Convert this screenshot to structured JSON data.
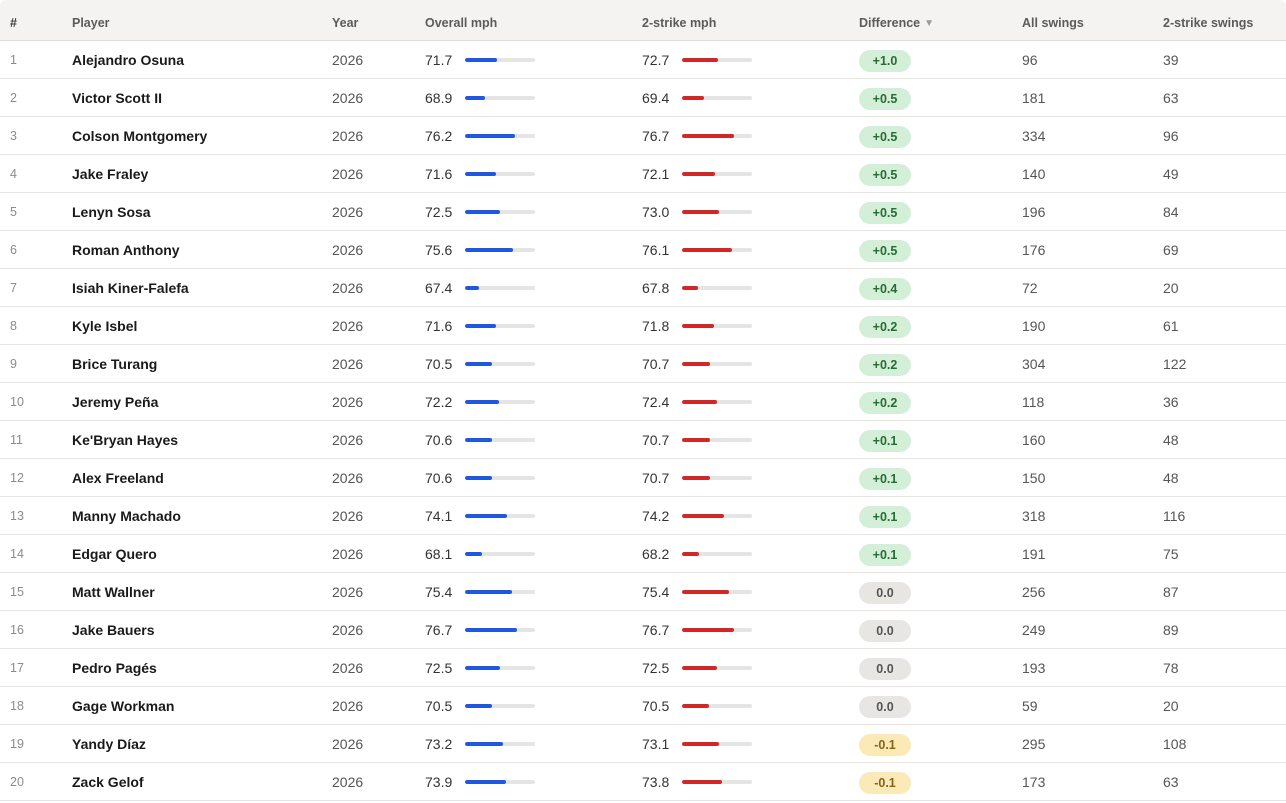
{
  "headers": {
    "rank": "#",
    "player": "Player",
    "year": "Year",
    "overall": "Overall mph",
    "two_strike": "2-strike mph",
    "difference": "Difference",
    "all_swings": "All swings",
    "two_strike_swings": "2-strike swings",
    "sort_icon": "sort-descending-icon",
    "sort_glyph": "▼"
  },
  "colors": {
    "overall_bar": "#1f57e0",
    "two_strike_bar": "#d22727",
    "positive_badge": "#d3efd8",
    "zero_badge": "#e7e6e3",
    "negative_badge": "#fbeab8"
  },
  "bar_scale": {
    "min_mph": 64,
    "max_mph": 81
  },
  "rows": [
    {
      "rank": "1",
      "player": "Alejandro Osuna",
      "year": "2026",
      "overall": "71.7",
      "two_strike": "72.7",
      "difference": "+1.0",
      "all_swings": "96",
      "two_strike_swings": "39"
    },
    {
      "rank": "2",
      "player": "Victor Scott II",
      "year": "2026",
      "overall": "68.9",
      "two_strike": "69.4",
      "difference": "+0.5",
      "all_swings": "181",
      "two_strike_swings": "63"
    },
    {
      "rank": "3",
      "player": "Colson Montgomery",
      "year": "2026",
      "overall": "76.2",
      "two_strike": "76.7",
      "difference": "+0.5",
      "all_swings": "334",
      "two_strike_swings": "96"
    },
    {
      "rank": "4",
      "player": "Jake Fraley",
      "year": "2026",
      "overall": "71.6",
      "two_strike": "72.1",
      "difference": "+0.5",
      "all_swings": "140",
      "two_strike_swings": "49"
    },
    {
      "rank": "5",
      "player": "Lenyn Sosa",
      "year": "2026",
      "overall": "72.5",
      "two_strike": "73.0",
      "difference": "+0.5",
      "all_swings": "196",
      "two_strike_swings": "84"
    },
    {
      "rank": "6",
      "player": "Roman Anthony",
      "year": "2026",
      "overall": "75.6",
      "two_strike": "76.1",
      "difference": "+0.5",
      "all_swings": "176",
      "two_strike_swings": "69"
    },
    {
      "rank": "7",
      "player": "Isiah Kiner-Falefa",
      "year": "2026",
      "overall": "67.4",
      "two_strike": "67.8",
      "difference": "+0.4",
      "all_swings": "72",
      "two_strike_swings": "20"
    },
    {
      "rank": "8",
      "player": "Kyle Isbel",
      "year": "2026",
      "overall": "71.6",
      "two_strike": "71.8",
      "difference": "+0.2",
      "all_swings": "190",
      "two_strike_swings": "61"
    },
    {
      "rank": "9",
      "player": "Brice Turang",
      "year": "2026",
      "overall": "70.5",
      "two_strike": "70.7",
      "difference": "+0.2",
      "all_swings": "304",
      "two_strike_swings": "122"
    },
    {
      "rank": "10",
      "player": "Jeremy Peña",
      "year": "2026",
      "overall": "72.2",
      "two_strike": "72.4",
      "difference": "+0.2",
      "all_swings": "118",
      "two_strike_swings": "36"
    },
    {
      "rank": "11",
      "player": "Ke'Bryan Hayes",
      "year": "2026",
      "overall": "70.6",
      "two_strike": "70.7",
      "difference": "+0.1",
      "all_swings": "160",
      "two_strike_swings": "48"
    },
    {
      "rank": "12",
      "player": "Alex Freeland",
      "year": "2026",
      "overall": "70.6",
      "two_strike": "70.7",
      "difference": "+0.1",
      "all_swings": "150",
      "two_strike_swings": "48"
    },
    {
      "rank": "13",
      "player": "Manny Machado",
      "year": "2026",
      "overall": "74.1",
      "two_strike": "74.2",
      "difference": "+0.1",
      "all_swings": "318",
      "two_strike_swings": "116"
    },
    {
      "rank": "14",
      "player": "Edgar Quero",
      "year": "2026",
      "overall": "68.1",
      "two_strike": "68.2",
      "difference": "+0.1",
      "all_swings": "191",
      "two_strike_swings": "75"
    },
    {
      "rank": "15",
      "player": "Matt Wallner",
      "year": "2026",
      "overall": "75.4",
      "two_strike": "75.4",
      "difference": "0.0",
      "all_swings": "256",
      "two_strike_swings": "87"
    },
    {
      "rank": "16",
      "player": "Jake Bauers",
      "year": "2026",
      "overall": "76.7",
      "two_strike": "76.7",
      "difference": "0.0",
      "all_swings": "249",
      "two_strike_swings": "89"
    },
    {
      "rank": "17",
      "player": "Pedro Pagés",
      "year": "2026",
      "overall": "72.5",
      "two_strike": "72.5",
      "difference": "0.0",
      "all_swings": "193",
      "two_strike_swings": "78"
    },
    {
      "rank": "18",
      "player": "Gage Workman",
      "year": "2026",
      "overall": "70.5",
      "two_strike": "70.5",
      "difference": "0.0",
      "all_swings": "59",
      "two_strike_swings": "20"
    },
    {
      "rank": "19",
      "player": "Yandy Díaz",
      "year": "2026",
      "overall": "73.2",
      "two_strike": "73.1",
      "difference": "-0.1",
      "all_swings": "295",
      "two_strike_swings": "108"
    },
    {
      "rank": "20",
      "player": "Zack Gelof",
      "year": "2026",
      "overall": "73.9",
      "two_strike": "73.8",
      "difference": "-0.1",
      "all_swings": "173",
      "two_strike_swings": "63"
    }
  ]
}
